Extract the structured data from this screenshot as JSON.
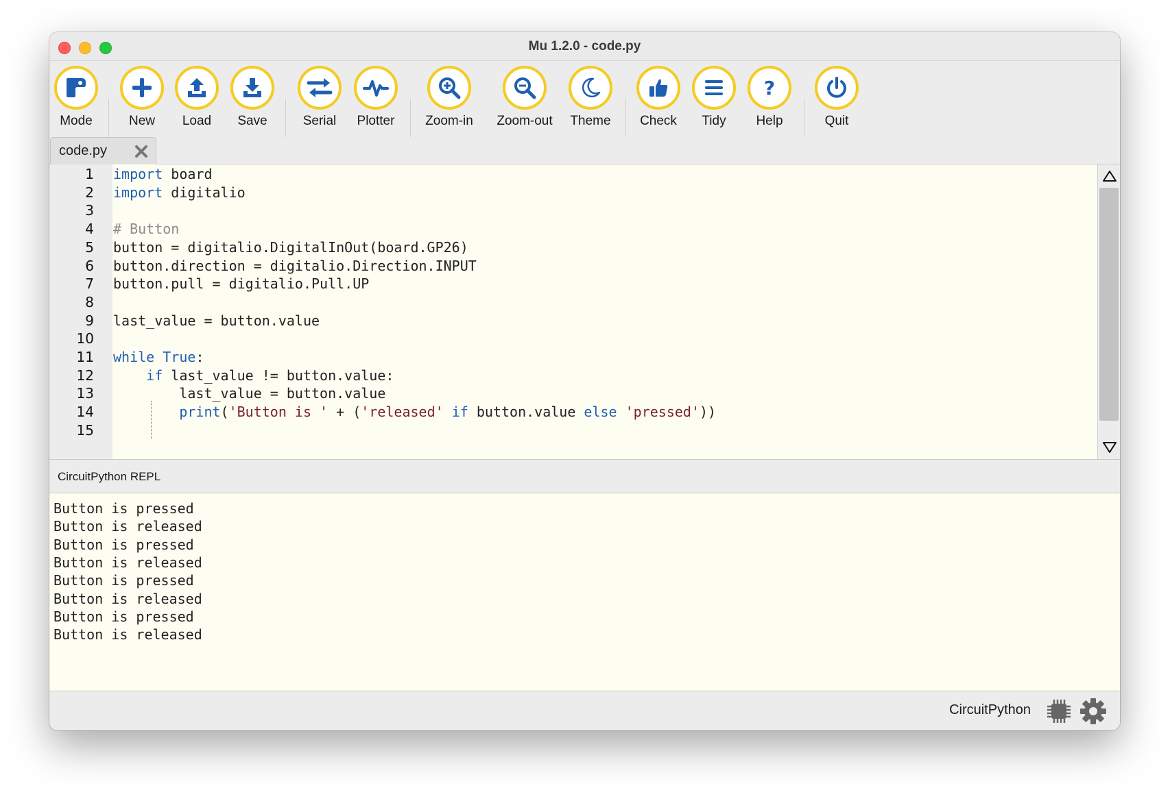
{
  "window": {
    "title": "Mu 1.2.0 - code.py"
  },
  "toolbar": {
    "mode": "Mode",
    "new": "New",
    "load": "Load",
    "save": "Save",
    "serial": "Serial",
    "plotter": "Plotter",
    "zoom_in": "Zoom-in",
    "zoom_out": "Zoom-out",
    "theme": "Theme",
    "check": "Check",
    "tidy": "Tidy",
    "help": "Help",
    "quit": "Quit",
    "accent_color": "#f4cc24",
    "icon_color": "#1f5fb0"
  },
  "tabs": [
    {
      "label": "code.py",
      "active": true
    }
  ],
  "editor": {
    "line_numbers": [
      "1",
      "2",
      "3",
      "4",
      "5",
      "6",
      "7",
      "8",
      "9",
      "10",
      "11",
      "12",
      "13",
      "14",
      "15"
    ],
    "lines": [
      [
        [
          "kw",
          "import"
        ],
        [
          "tx",
          " board"
        ]
      ],
      [
        [
          "kw",
          "import"
        ],
        [
          "tx",
          " digitalio"
        ]
      ],
      [],
      [
        [
          "cm",
          "# Button"
        ]
      ],
      [
        [
          "tx",
          "button = digitalio.DigitalInOut(board.GP26)"
        ]
      ],
      [
        [
          "tx",
          "button.direction = digitalio.Direction.INPUT"
        ]
      ],
      [
        [
          "tx",
          "button.pull = digitalio.Pull.UP"
        ]
      ],
      [],
      [
        [
          "tx",
          "last_value = button.value"
        ]
      ],
      [],
      [
        [
          "kw",
          "while"
        ],
        [
          "tx",
          " "
        ],
        [
          "kw",
          "True"
        ],
        [
          "tx",
          ":"
        ]
      ],
      [
        [
          "tx",
          "    "
        ],
        [
          "kw",
          "if"
        ],
        [
          "tx",
          " last_value != button.value:"
        ]
      ],
      [
        [
          "tx",
          "        last_value = button.value"
        ]
      ],
      [
        [
          "tx",
          "        "
        ],
        [
          "kw",
          "print"
        ],
        [
          "tx",
          "("
        ],
        [
          "st",
          "'Button is '"
        ],
        [
          "tx",
          " + ("
        ],
        [
          "st",
          "'released'"
        ],
        [
          "tx",
          " "
        ],
        [
          "kw",
          "if"
        ],
        [
          "tx",
          " button.value "
        ],
        [
          "kw",
          "else"
        ],
        [
          "tx",
          " "
        ],
        [
          "st",
          "'pressed'"
        ],
        [
          "tx",
          "))"
        ]
      ],
      []
    ]
  },
  "repl": {
    "title": "CircuitPython REPL",
    "output": [
      "Button is pressed",
      "Button is released",
      "Button is pressed",
      "Button is released",
      "Button is pressed",
      "Button is released",
      "Button is pressed",
      "Button is released"
    ]
  },
  "status": {
    "mode": "CircuitPython"
  }
}
